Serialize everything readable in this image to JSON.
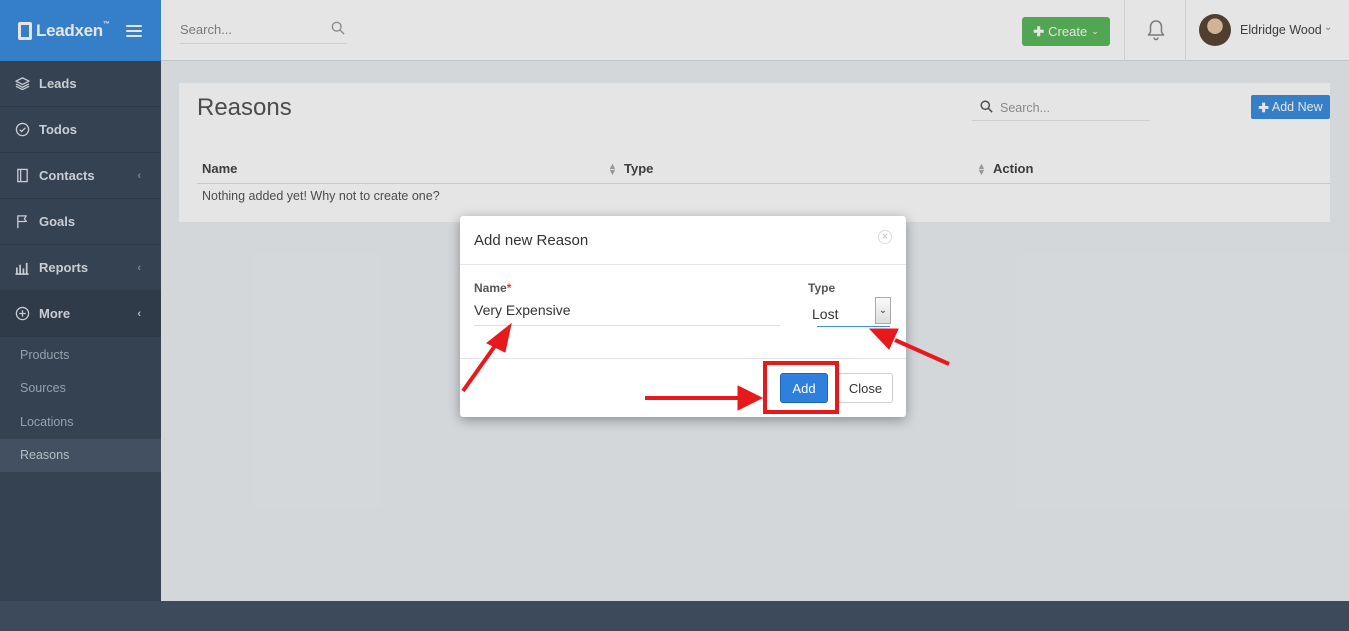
{
  "app": {
    "brand": "Leadxen",
    "trademark": "™"
  },
  "sidebar": {
    "items": [
      {
        "label": "Leads",
        "icon": "layers-icon"
      },
      {
        "label": "Todos",
        "icon": "check-circle-icon"
      },
      {
        "label": "Contacts",
        "icon": "contact-book-icon",
        "chevron": "‹"
      },
      {
        "label": "Goals",
        "icon": "flag-icon"
      },
      {
        "label": "Reports",
        "icon": "bar-chart-icon",
        "chevron": "‹"
      },
      {
        "label": "More",
        "icon": "plus-circle-icon",
        "chevron": "‹"
      }
    ],
    "sub_items": [
      {
        "label": "Products"
      },
      {
        "label": "Sources"
      },
      {
        "label": "Locations"
      },
      {
        "label": "Reasons",
        "active": true
      }
    ]
  },
  "topbar": {
    "search_placeholder": "Search...",
    "create_label": "Create",
    "user_name": "Eldridge Wood"
  },
  "page": {
    "title": "Reasons",
    "search_placeholder": "Search...",
    "add_new_label": "Add New",
    "columns": [
      "Name",
      "Type",
      "Action"
    ],
    "empty_message": "Nothing added yet! Why not to create one?"
  },
  "modal": {
    "title": "Add new Reason",
    "close_glyph": "×",
    "name_label": "Name",
    "required_mark": "*",
    "name_value": "Very Expensive",
    "type_label": "Type",
    "type_value": "Lost",
    "add_label": "Add",
    "close_label": "Close"
  },
  "colors": {
    "brand": "#3a8ede",
    "sidebar": "#3c4a5b",
    "create": "#5cb85c",
    "annotation": "#e8191b"
  }
}
